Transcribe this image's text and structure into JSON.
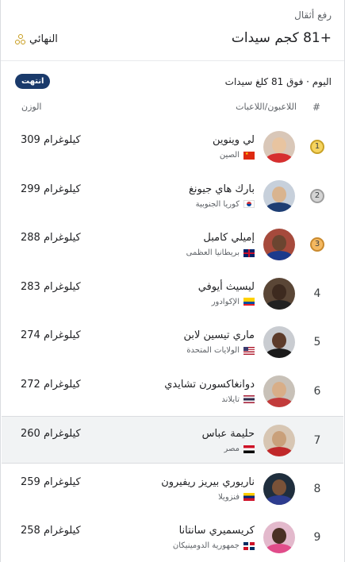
{
  "header": {
    "sport": "رفع أثقال",
    "event": "+81 كجم سيدات",
    "stage": "النهائي"
  },
  "subheader": {
    "today": "اليوم · فوق 81 كلغ سيدات",
    "status": "انتهت"
  },
  "columns": {
    "num": "#",
    "athlete": "اللاعبون/اللاعبات",
    "weight": "الوزن"
  },
  "rows": [
    {
      "rank": "1",
      "medal": "gold",
      "name": "لي وينوين",
      "country": "الصين",
      "flag": "china",
      "weight": "309 كيلوغرام"
    },
    {
      "rank": "2",
      "medal": "silver",
      "name": "بارك هاي جيونغ",
      "country": "كوريا الجنوبية",
      "flag": "korea",
      "weight": "299 كيلوغرام"
    },
    {
      "rank": "3",
      "medal": "bronze",
      "name": "إميلي كامبل",
      "country": "بريطانيا العظمى",
      "flag": "uk",
      "weight": "288 كيلوغرام"
    },
    {
      "rank": "4",
      "medal": "",
      "name": "ليسيث أيوفي",
      "country": "الإكوادور",
      "flag": "ecuador",
      "weight": "283 كيلوغرام"
    },
    {
      "rank": "5",
      "medal": "",
      "name": "ماري تيسين لابن",
      "country": "الولايات المتحدة",
      "flag": "usa",
      "weight": "274 كيلوغرام"
    },
    {
      "rank": "6",
      "medal": "",
      "name": "دوانغاكسورن تشايدي",
      "country": "تايلاند",
      "flag": "thailand",
      "weight": "272 كيلوغرام"
    },
    {
      "rank": "7",
      "medal": "",
      "name": "حليمة عباس",
      "country": "مصر",
      "flag": "egypt",
      "weight": "260 كيلوغرام"
    },
    {
      "rank": "8",
      "medal": "",
      "name": "ناريوري بيريز ريفيرون",
      "country": "فنزويلا",
      "flag": "venezuela",
      "weight": "259 كيلوغرام"
    },
    {
      "rank": "9",
      "medal": "",
      "name": "كريسميري سانتانا",
      "country": "جمهورية الدومينيكان",
      "flag": "dominican",
      "weight": "258 كيلوغرام"
    }
  ],
  "colors": {
    "badge_bg": "#1a3a6b",
    "highlight_row": "#f1f3f4"
  }
}
